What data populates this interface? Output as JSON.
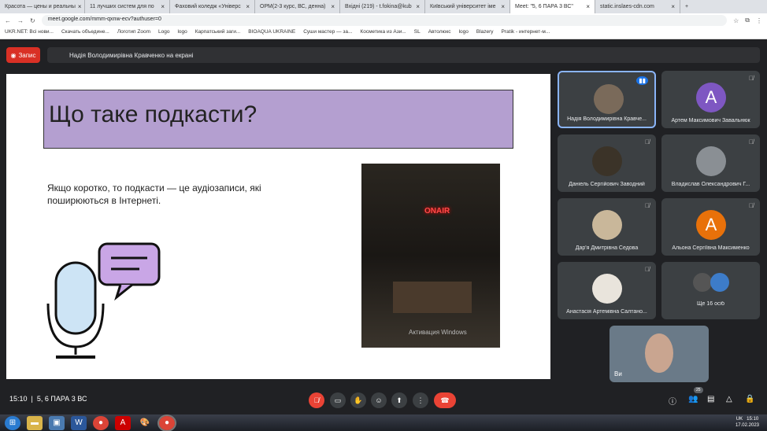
{
  "tabs": [
    {
      "label": "Красота — цены и реальны"
    },
    {
      "label": "11 лучших систем для по"
    },
    {
      "label": "Фаховий коледж «Універс"
    },
    {
      "label": "ОРМ(2-3 курс, ВС, денна)"
    },
    {
      "label": "Вхідні (219) - t.fokina@kub"
    },
    {
      "label": "Київський університет іме"
    },
    {
      "label": "Meet: \"5, 6 ПАРА 3 ВС\""
    },
    {
      "label": "static.inslaes-cdn.com"
    }
  ],
  "url": "meet.google.com/mmm-qxnw-ecv?authuser=0",
  "bookmarks": [
    "UKR.NET: Всі нови...",
    "Скачать объедине...",
    "Логотип Zoom",
    "Logo",
    "logo",
    "Карпатський заги...",
    "BIOAQUA UKRAINE",
    "Суши мастер — за...",
    "Косметика из Ази...",
    "SL",
    "Автолюкс",
    "logo",
    "Blazery",
    "Pratik - интернет-м..."
  ],
  "recording_label": "Запис",
  "presenting_banner": "Надія Володимирівна Кравченко на екрані",
  "slide": {
    "title": "Що таке подкасти?",
    "text": "Якщо коротко, то подкасти — це аудіозаписи, які поширюються в Інтернеті.",
    "photo_sign": "ONAIR",
    "watermark": "Активация Windows"
  },
  "participants": [
    {
      "name": "Надія Володимирівна Кравче...",
      "initial": "",
      "color": "#7a6a5a"
    },
    {
      "name": "Артем Максимович Завальнюк",
      "initial": "A",
      "color": "#7e57c2"
    },
    {
      "name": "Даніель Сергійович Заводний",
      "initial": "",
      "color": "#3b3328"
    },
    {
      "name": "Владислав Олександрович Г...",
      "initial": "",
      "color": "#8a8f94"
    },
    {
      "name": "Дар'я Дмитрівна Седова",
      "initial": "",
      "color": "#c9b79a"
    },
    {
      "name": "Альона Сергіївна Максименко",
      "initial": "A",
      "color": "#e8710a"
    },
    {
      "name": "Анастасія Артемівна Салтано...",
      "initial": "",
      "color": "#e9e4dc"
    }
  ],
  "more_label": "Ще 16 осіб",
  "self_label": "Ви",
  "bottom": {
    "time": "15:10",
    "meeting": "5, 6 ПАРА 3 ВС",
    "participants_count": "25"
  },
  "taskbar": {
    "lang": "UK",
    "time": "15:10",
    "date": "17.02.2023"
  }
}
